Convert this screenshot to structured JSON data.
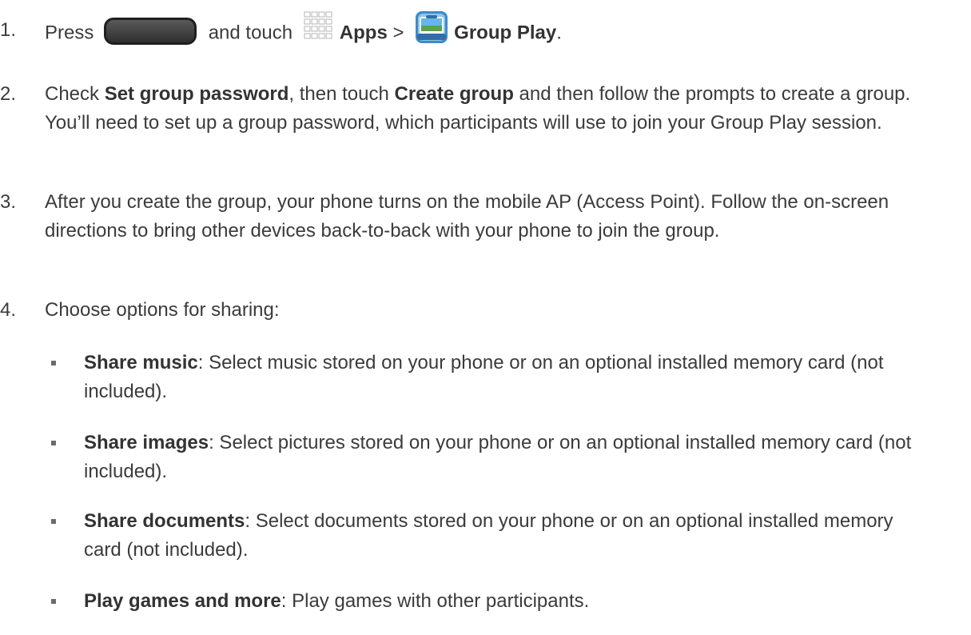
{
  "steps": [
    {
      "number": "1.",
      "parts": {
        "t1": "Press",
        "t2": "and touch",
        "apps_bold": "Apps",
        "t3": ">",
        "group_play_bold": "Group Play",
        "t4": "."
      },
      "icons": [
        "home-key-icon",
        "apps-grid-icon",
        "group-play-app-icon"
      ]
    },
    {
      "number": "2.",
      "parts": {
        "t1": "Check",
        "b1": "Set group password",
        "t2": ", then touch",
        "b2": "Create group",
        "t3": "and then follow the prompts to create a group. You’ll need to set up a group password, which participants will use to join your Group Play session."
      }
    },
    {
      "number": "3.",
      "text": "After you create the group, your phone turns on the mobile AP (Access Point). Follow the on-screen directions to bring other devices back-to-back with your phone to join the group."
    },
    {
      "number": "4.",
      "text": "Choose options for sharing:"
    }
  ],
  "options": [
    {
      "title": "Share music",
      "text": ": Select music stored on your phone or on an optional installed memory card (not included)."
    },
    {
      "title": "Share images",
      "text": ": Select pictures stored on your phone or on an optional installed memory card (not included)."
    },
    {
      "title": "Share documents",
      "text": ": Select documents stored on your phone or on an optional installed memory card (not included)."
    },
    {
      "title": "Play games and more",
      "text": ": Play games with other participants."
    }
  ],
  "colors": {
    "text": "#3b3b3b",
    "bullet": "#6b6b6b"
  }
}
